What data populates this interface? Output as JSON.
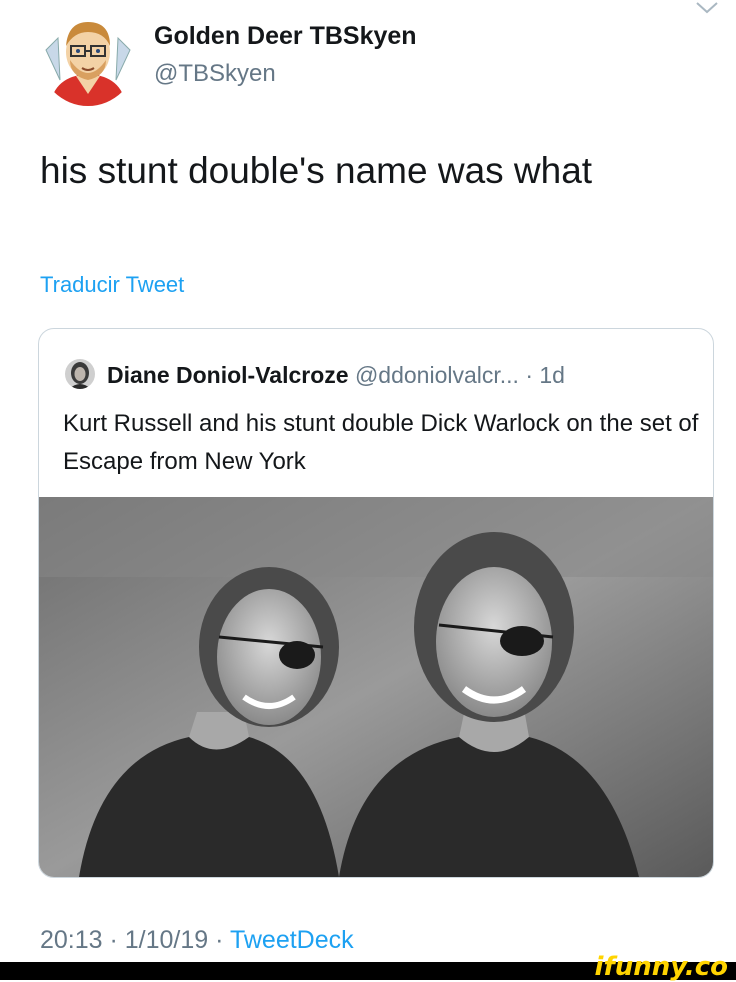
{
  "tweet": {
    "display_name": "Golden Deer TBSkyen",
    "handle": "@TBSkyen",
    "text": "his stunt double's name was what",
    "translate_label": "Traducir Tweet",
    "timestamp": "20:13 · 1/10/19 · ",
    "source": "TweetDeck"
  },
  "quoted_tweet": {
    "display_name": "Diane Doniol-Valcroze",
    "handle": " @ddoniolvalcr...",
    "time": " · 1d",
    "text": "Kurt Russell and his stunt double Dick Warlock on the set of Escape from New York"
  },
  "watermark": "ifunny.co",
  "icons": {
    "menu": "chevron-down-icon"
  },
  "colors": {
    "link": "#1da1f2",
    "secondary_text": "#657786",
    "border": "#ccd6dd"
  }
}
